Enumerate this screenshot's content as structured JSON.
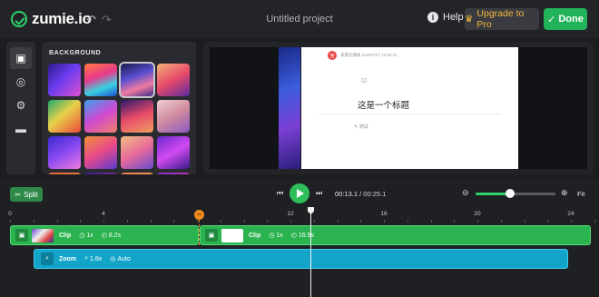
{
  "app": {
    "name": "zumie.io",
    "project_title": "Untitled project"
  },
  "topbar": {
    "help_label": "Help",
    "upgrade_label": "Upgrade to Pro",
    "done_label": "Done",
    "accent": "#22b35a",
    "upgrade_color": "#f3b73a"
  },
  "sidebar": {
    "items": [
      {
        "name": "image-icon",
        "glyph": "▣",
        "active": true
      },
      {
        "name": "cursor-icon",
        "glyph": "◎",
        "active": false
      },
      {
        "name": "gear-icon",
        "glyph": "⚙",
        "active": false
      },
      {
        "name": "briefcase-icon",
        "glyph": "▬",
        "active": false
      }
    ]
  },
  "background_panel": {
    "title": "BACKGROUND",
    "selected_index": 2,
    "tiles": [
      "linear-gradient(135deg,#2b1a8a,#6a3cf0 45%,#e04fd0)",
      "linear-gradient(160deg,#ff7a3d,#e83a8c 40%,#3bd1e0 70%,#1a4fd0)",
      "linear-gradient(160deg,#1a1a4a,#5a4fd0 40%,#f07aa0 70%,#3a2a8a)",
      "linear-gradient(150deg,#f4b27a,#e84a6a 50%,#5a2aa0)",
      "linear-gradient(140deg,#1fa86a,#e8d04a 45%,#e84a3a)",
      "linear-gradient(150deg,#3aa0f0,#d04ad0 50%,#f0806a)",
      "linear-gradient(160deg,#2a1a6a,#e84a6a 50%,#f0a060)",
      "linear-gradient(150deg,#f0d0d0,#d08aa0 50%,#8a5ac0)",
      "linear-gradient(150deg,#3a2ad0,#8a4af0 50%,#f07ae0)",
      "linear-gradient(150deg,#f0903a,#e84a8a 50%,#5a3ad0)",
      "linear-gradient(150deg,#f0c080,#e86a9a 50%,#6a4ad0)",
      "linear-gradient(150deg,#6a2ad0,#d04af0 50%,#3a1a8a)",
      "linear-gradient(150deg,#e8603a,#f0a04a)",
      "linear-gradient(150deg,#3a1a8a,#d04a9a)",
      "linear-gradient(150deg,#f07a4a,#f0c07a)",
      "linear-gradient(150deg,#8a2ad0,#f04a7a)"
    ]
  },
  "preview": {
    "doc_author_initial": "官",
    "doc_meta": "掌握云播报 2025/7/27 12:48:21",
    "doc_icon": "☑",
    "doc_title": "这是一个标题",
    "doc_note": "✎ 测试"
  },
  "timeline": {
    "split_label": "Split",
    "current_time": "00:13.1",
    "total_time": "/ 00:25.1",
    "zoom_level": 0.43,
    "fit_label": "Fit",
    "ruler": [
      "0",
      "4",
      "8",
      "12",
      "16",
      "20",
      "24"
    ],
    "marker_glyph": "✂",
    "clips": [
      {
        "label": "Clip",
        "speed": "1x",
        "duration": "8.2s"
      },
      {
        "label": "Clip",
        "speed": "1x",
        "duration": "16.9s"
      }
    ],
    "zoom_track": {
      "label": "Zoom",
      "factor": "1.8x",
      "mode": "Auto"
    }
  }
}
